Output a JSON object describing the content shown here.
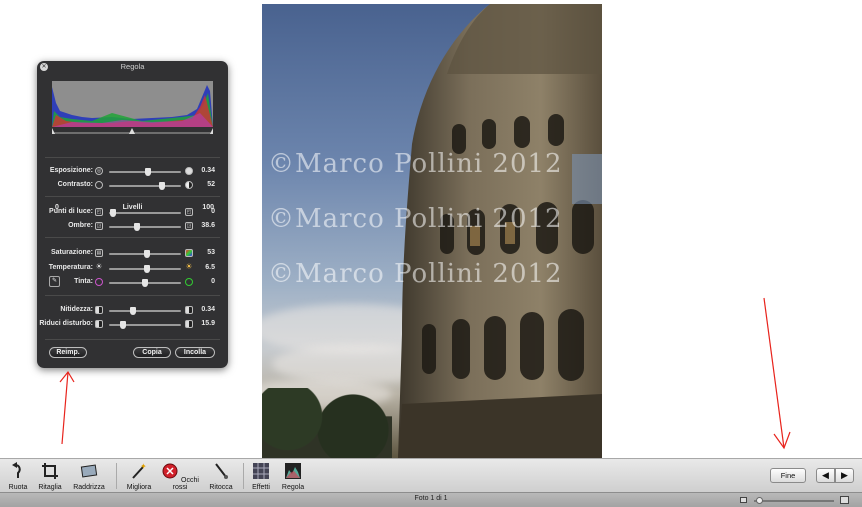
{
  "photo": {
    "watermarks": [
      "©Marco Pollini 2012",
      "©Marco Pollini 2012",
      "©Marco Pollini 2012"
    ]
  },
  "adjust_panel": {
    "title": "Regola",
    "levels": {
      "min": "0",
      "label": "Livelli",
      "max": "100"
    },
    "rows": [
      {
        "label": "Esposizione:",
        "value": "0.34",
        "level": 0.55
      },
      {
        "label": "Contrasto:",
        "value": "52",
        "level": 0.75
      },
      {
        "label": "Punti di luce:",
        "value": "0",
        "level": 0.02
      },
      {
        "label": "Ombre:",
        "value": "38.6",
        "level": 0.38
      },
      {
        "label": "Saturazione:",
        "value": "53",
        "level": 0.53
      },
      {
        "label": "Temperatura:",
        "value": "6.5",
        "level": 0.53
      },
      {
        "label": "Tinta:",
        "value": "0",
        "level": 0.5
      },
      {
        "label": "Nitidezza:",
        "value": "0.34",
        "level": 0.32
      },
      {
        "label": "Riduci disturbo:",
        "value": "15.9",
        "level": 0.16
      }
    ],
    "buttons": {
      "reset": "Reimp.",
      "copy": "Copia",
      "paste": "Incolla"
    }
  },
  "toolbar": {
    "tools": [
      {
        "label": "Ruota",
        "icon": "rotate-icon"
      },
      {
        "label": "Ritaglia",
        "icon": "crop-icon"
      },
      {
        "label": "Raddrizza",
        "icon": "straighten-icon"
      },
      {
        "label": "Migliora",
        "icon": "magic-wand-icon"
      },
      {
        "label": "Occhi rossi",
        "icon": "red-eye-icon"
      },
      {
        "label": "Ritocca",
        "icon": "retouch-brush-icon"
      },
      {
        "label": "Effetti",
        "icon": "effects-grid-icon"
      },
      {
        "label": "Regola",
        "icon": "adjust-histogram-icon"
      }
    ],
    "done_label": "Fine",
    "prev_icon": "arrow-left-icon",
    "next_icon": "arrow-right-icon"
  },
  "status": {
    "photo_count": "Foto 1 di 1",
    "zoom_level": 0.03
  },
  "colors": {
    "annotation_arrow": "#e8231c",
    "panel_bg": "#202022",
    "toolbar_bg": "#dcdcdc"
  }
}
